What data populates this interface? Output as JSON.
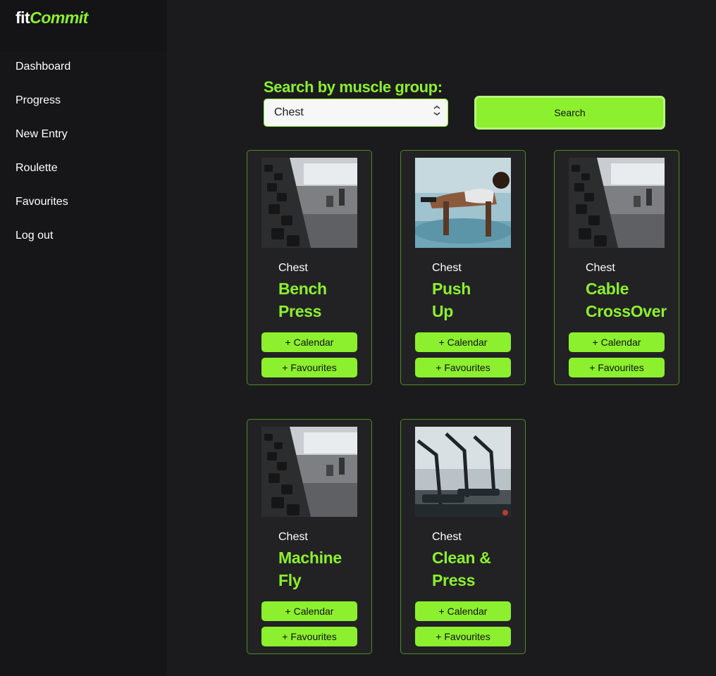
{
  "app": {
    "logo_prefix": "fit",
    "logo_suffix": "Commit",
    "accent_color": "#8cf02e",
    "background_color": "#1b1b1d"
  },
  "sidebar": {
    "items": [
      {
        "label": "Dashboard"
      },
      {
        "label": "Progress"
      },
      {
        "label": "New Entry"
      },
      {
        "label": "Roulette"
      },
      {
        "label": "Favourites"
      },
      {
        "label": "Log out"
      }
    ]
  },
  "search": {
    "label": "Search by muscle group:",
    "selected": "Chest",
    "button_label": "Search"
  },
  "cards": [
    {
      "category": "Chest",
      "title_line1": "Bench",
      "title_line2": "Press",
      "image": "dumbbell-rack-photo",
      "calendar_label": "+ Calendar",
      "favourites_label": "+ Favourites"
    },
    {
      "category": "Chest",
      "title_line1": "Push",
      "title_line2": "Up",
      "image": "push-up-photo",
      "calendar_label": "+ Calendar",
      "favourites_label": "+ Favourites"
    },
    {
      "category": "Chest",
      "title_line1": "Cable",
      "title_line2": "CrossOver",
      "image": "dumbbell-rack-photo",
      "calendar_label": "+ Calendar",
      "favourites_label": "+ Favourites"
    },
    {
      "category": "Chest",
      "title_line1": "Machine",
      "title_line2": "Fly",
      "image": "dumbbell-rack-photo",
      "calendar_label": "+ Calendar",
      "favourites_label": "+ Favourites"
    },
    {
      "category": "Chest",
      "title_line1": "Clean &",
      "title_line2": "Press",
      "image": "gym-machines-photo",
      "calendar_label": "+ Calendar",
      "favourites_label": "+ Favourites"
    }
  ]
}
